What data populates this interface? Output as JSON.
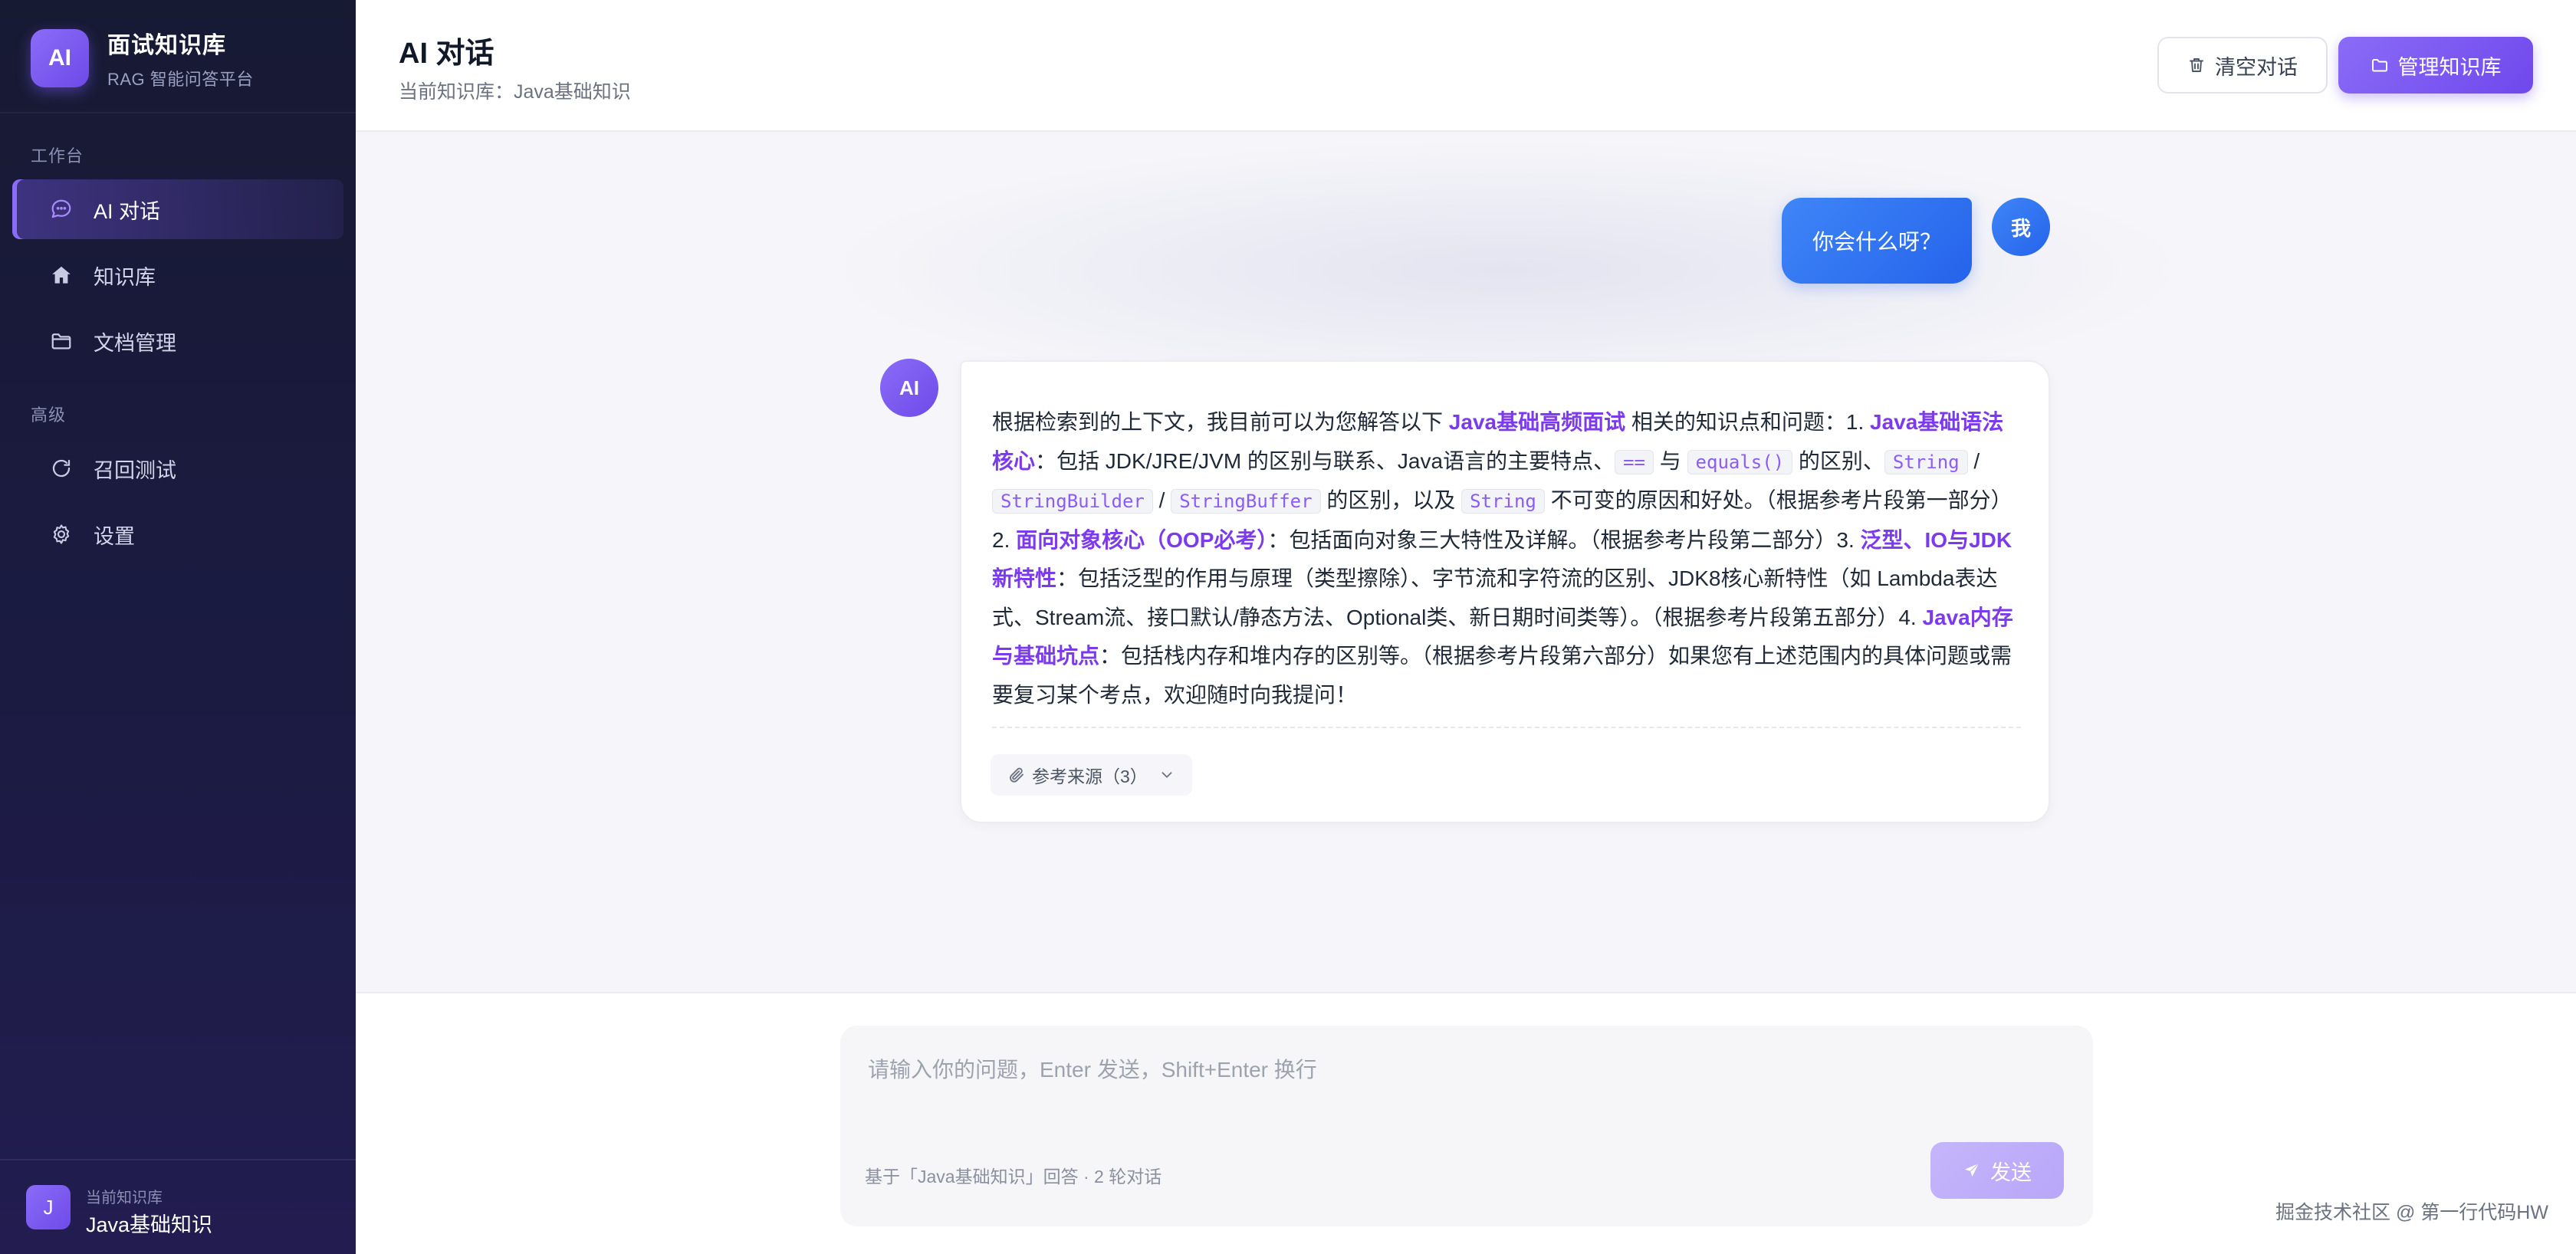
{
  "brand": {
    "logo": "AI",
    "title": "面试知识库",
    "subtitle": "RAG 智能问答平台"
  },
  "sidebar": {
    "groups": [
      {
        "label": "工作台"
      },
      {
        "label": "高级"
      }
    ],
    "items": [
      {
        "label": "AI 对话",
        "icon": "chat-bubble-icon",
        "active": true
      },
      {
        "label": "知识库",
        "icon": "home-icon",
        "active": false
      },
      {
        "label": "文档管理",
        "icon": "folder-icon",
        "active": false
      },
      {
        "label": "召回测试",
        "icon": "refresh-icon",
        "active": false
      },
      {
        "label": "设置",
        "icon": "gear-icon",
        "active": false
      }
    ],
    "footer": {
      "avatar": "J",
      "label": "当前知识库",
      "name": "Java基础知识"
    }
  },
  "header": {
    "title": "AI 对话",
    "subtitle": "当前知识库：Java基础知识",
    "clear_label": "清空对话",
    "manage_label": "管理知识库"
  },
  "chat": {
    "user": {
      "avatar": "我",
      "message": "你会什么呀？"
    },
    "ai": {
      "avatar": "AI",
      "segments": {
        "s1": "根据检索到的上下文，我目前可以为您解答以下 ",
        "b1": "Java基础高频面试",
        "s2": " 相关的知识点和问题：1. ",
        "b2": "Java基础语法核心",
        "s3": "：包括 JDK/JRE/JVM 的区别与联系、Java语言的主要特点、",
        "c1": "==",
        "s4": " 与 ",
        "c2": "equals()",
        "s5": " 的区别、",
        "c3": "String",
        "s6": " / ",
        "c4": "StringBuilder",
        "s7": " / ",
        "c5": "StringBuffer",
        "s8": " 的区别，以及 ",
        "c6": "String",
        "s9": " 不可变的原因和好处。（根据参考片段第一部分）2. ",
        "b3": "面向对象核心（OOP必考）",
        "s10": "：包括面向对象三大特性及详解。（根据参考片段第二部分）3. ",
        "b4": "泛型、IO与JDK新特性",
        "s11": "：包括泛型的作用与原理（类型擦除）、字节流和字符流的区别、JDK8核心新特性（如 Lambda表达式、Stream流、接口默认/静态方法、Optional类、新日期时间类等）。（根据参考片段第五部分）4. ",
        "b5": "Java内存与基础坑点",
        "s12": "：包括栈内存和堆内存的区别等。（根据参考片段第六部分）如果您有上述范围内的具体问题或需要复习某个考点，欢迎随时向我提问！"
      },
      "refs_label": "参考来源（3）"
    }
  },
  "composer": {
    "placeholder": "请输入你的问题，Enter 发送，Shift+Enter 换行",
    "value": "",
    "hint": "基于「Java基础知识」回答 · 2 轮对话",
    "send_label": "发送"
  },
  "watermark": "掘金技术社区 @ 第一行代码HW",
  "colors": {
    "accent": "#7c5cf6",
    "user_bubble": "#2f74f0",
    "sidebar_bg": "#1b1b42"
  }
}
